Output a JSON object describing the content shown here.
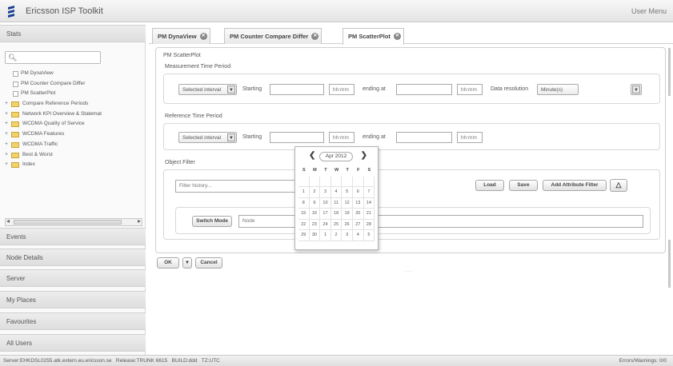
{
  "app": {
    "title": "Ericsson ISP Toolkit",
    "user_menu": "User Menu"
  },
  "sidebar": {
    "sections": [
      "Stats",
      "Events",
      "Node Details",
      "Server",
      "My Places",
      "Favourites",
      "All Users"
    ],
    "search_placeholder": "",
    "tree": [
      {
        "label": "PM DynaView",
        "kind": "leaf"
      },
      {
        "label": "PM Counter Compare Differ",
        "kind": "leaf"
      },
      {
        "label": "PM ScatterPlot",
        "kind": "leaf"
      },
      {
        "label": "Compare Reference Periods",
        "kind": "folder"
      },
      {
        "label": "Network KPI Overview & Statemat",
        "kind": "folder"
      },
      {
        "label": "WCDMA Quality of Service",
        "kind": "folder"
      },
      {
        "label": "WCDMA Features",
        "kind": "folder"
      },
      {
        "label": "WCDMA Traffic",
        "kind": "folder"
      },
      {
        "label": "Best & Worst",
        "kind": "folder"
      },
      {
        "label": "Index",
        "kind": "folder"
      }
    ]
  },
  "tabs": [
    {
      "label": "PM DynaView",
      "active": false
    },
    {
      "label": "PM Counter Compare Differ",
      "active": false
    },
    {
      "label": "PM ScatterPlot",
      "active": true
    }
  ],
  "main": {
    "panel_title": "PM ScatterPlot",
    "measurement": {
      "title": "Measurement Time Period",
      "interval": "Selected interval",
      "starting_label": "Starting",
      "start_time": "hh:mm",
      "ending_label": "ending at",
      "end_time": "hh:mm",
      "resolution_label": "Data resolution",
      "resolution": "Minute(s)"
    },
    "reference": {
      "title": "Reference Time Period",
      "interval": "Selected interval",
      "starting_label": "Starting",
      "start_time": "hh:mm",
      "ending_label": "ending at",
      "end_time": "hh:mm"
    },
    "object_filter": {
      "title": "Object Filter",
      "filter_placeholder": "Filter history...",
      "load_label": "Load",
      "save_label": "Save",
      "add_attr_label": "Add Attribute Filter",
      "switch_mode_label": "Switch Mode",
      "node_label": "Node"
    }
  },
  "calendar": {
    "month": "Apr 2012",
    "weekdays": [
      "S",
      "M",
      "T",
      "W",
      "T",
      "F",
      "S"
    ],
    "days": [
      "",
      "",
      "",
      "",
      "",
      "",
      "",
      "1",
      "2",
      "3",
      "4",
      "5",
      "6",
      "7",
      "8",
      "9",
      "10",
      "11",
      "12",
      "13",
      "14",
      "15",
      "16",
      "17",
      "18",
      "19",
      "20",
      "21",
      "22",
      "23",
      "24",
      "25",
      "26",
      "27",
      "28",
      "29",
      "30",
      "1",
      "2",
      "3",
      "4",
      "5"
    ]
  },
  "footer": {
    "ok_label": "OK",
    "cancel_label": "Cancel"
  },
  "status": {
    "server": "Server:EHKDSL0255.atk.extern.eu.ericsson.se",
    "release": "Release:TRUNK 6615",
    "build": "BUILD:ddd",
    "tz": "TZ:UTC",
    "errors": "Errors/Warnings: 0/0"
  }
}
